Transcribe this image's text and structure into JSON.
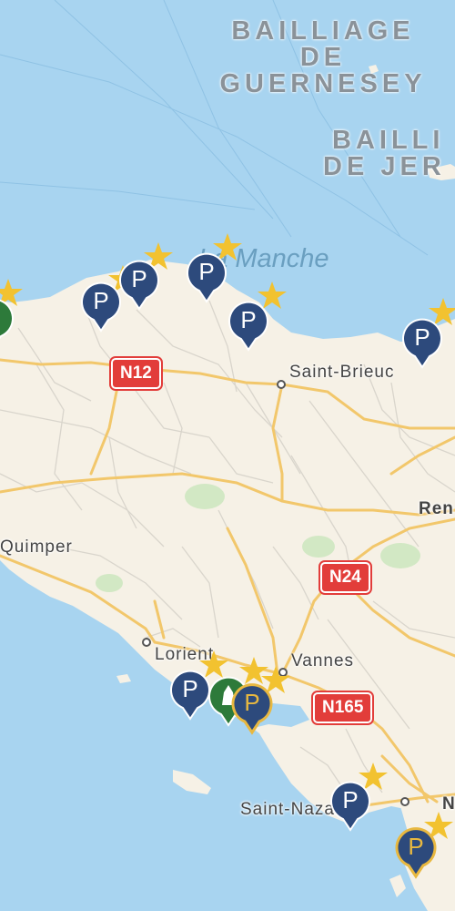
{
  "map": {
    "regions": {
      "guernesey": [
        "BAILLIAGE",
        "DE",
        "GUERNESEY"
      ],
      "jersey": [
        "BAILLI",
        "DE JER"
      ]
    },
    "sea_label": "La Manche",
    "cities": {
      "saint_brieuc": "Saint-Brieuc",
      "quimper": "Quimper",
      "lorient": "Lorient",
      "vannes": "Vannes",
      "saint_nazaire": "Saint-Nazaire",
      "rennes_partial": "Ren",
      "nantes_partial": "N"
    },
    "roads": {
      "n12": "N12",
      "n24": "N24",
      "n165": "N165"
    },
    "pins": {
      "parking_symbol": "P",
      "colors": {
        "parking": "#2d4a7c",
        "parking_selected": "#e8b840",
        "nature": "#2d7a3a",
        "star": "#f2c230"
      }
    }
  }
}
